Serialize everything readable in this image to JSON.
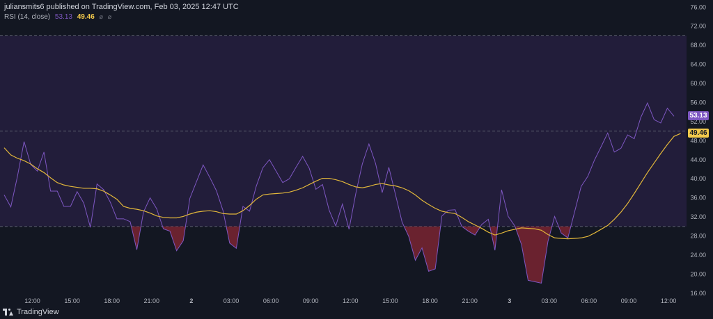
{
  "header": {
    "attribution": "juliansmits6 published on TradingView.com, Feb 03, 2025 12:47 UTC"
  },
  "legend": {
    "indicator_label": "RSI (14, close)",
    "rsi_value": "53.13",
    "ma_value": "49.46",
    "visibility_icon": "eye-off-icon",
    "settings_icon": "gear-icon"
  },
  "footer": {
    "brand": "TradingView",
    "logo_icon": "tradingview-logo-icon"
  },
  "colors": {
    "background": "#131722",
    "band_fill": "#221d3a",
    "rsi_line": "#7e57c2",
    "ma_line": "#e2b73a",
    "oversold_fill": "#7a2431",
    "dashed_level": "#5d6070",
    "axis_text": "#b2b5be",
    "rsi_tag": "#7e57c2",
    "ma_tag": "#f2c94c"
  },
  "chart_data": {
    "type": "line",
    "y_axis_ticks": [
      "76.00",
      "72.00",
      "68.00",
      "64.00",
      "60.00",
      "56.00",
      "52.00",
      "48.00",
      "44.00",
      "40.00",
      "36.00",
      "32.00",
      "28.00",
      "24.00",
      "20.00",
      "16.00"
    ],
    "x_axis_ticks": [
      "12:00",
      "15:00",
      "18:00",
      "21:00",
      "2",
      "03:00",
      "06:00",
      "09:00",
      "12:00",
      "15:00",
      "18:00",
      "21:00",
      "3",
      "03:00",
      "06:00",
      "09:00",
      "12:00"
    ],
    "ylim": [
      13.5,
      77.5
    ],
    "levels": {
      "upper": 70,
      "middle": 50,
      "lower": 30
    },
    "last_values": {
      "rsi": "53.13",
      "ma": "49.46"
    },
    "series": [
      {
        "id": "rsi",
        "values": [
          36.6,
          34.1,
          40.5,
          47.8,
          43.0,
          41.6,
          45.6,
          37.4,
          37.4,
          34.2,
          34.2,
          37.3,
          34.9,
          29.8,
          38.9,
          37.7,
          35.1,
          31.6,
          31.6,
          31.0,
          25.1,
          33.0,
          36.0,
          33.7,
          29.5,
          29.0,
          24.9,
          27.0,
          35.9,
          39.4,
          42.9,
          40.3,
          37.5,
          33.3,
          26.5,
          25.4,
          34.2,
          33.2,
          38.4,
          42.3,
          44.0,
          41.6,
          39.2,
          40.0,
          42.4,
          44.7,
          42.2,
          37.8,
          38.8,
          33.4,
          30.1,
          34.7,
          29.4,
          36.8,
          43.1,
          47.3,
          43.2,
          37.1,
          42.4,
          36.7,
          30.9,
          27.9,
          22.9,
          25.5,
          20.6,
          21.1,
          32.2,
          33.4,
          33.5,
          30.0,
          29.0,
          28.2,
          30.4,
          31.5,
          25.0,
          37.7,
          32.1,
          30.1,
          26.2,
          18.7,
          18.4,
          18.1,
          26.9,
          32.1,
          28.6,
          27.6,
          33.0,
          38.4,
          40.5,
          43.9,
          46.7,
          49.6,
          45.6,
          46.4,
          49.2,
          48.4,
          52.9,
          55.9,
          52.4,
          51.7,
          54.8,
          53.1
        ]
      },
      {
        "id": "rsi-ma",
        "values": [
          46.5,
          45.0,
          44.3,
          43.8,
          43.1,
          42.1,
          41.3,
          40.2,
          39.2,
          38.7,
          38.4,
          38.2,
          38.0,
          38.0,
          37.9,
          37.4,
          36.6,
          35.7,
          34.2,
          33.8,
          33.6,
          33.3,
          32.8,
          32.2,
          31.9,
          31.8,
          31.8,
          32.1,
          32.6,
          33.0,
          33.2,
          33.3,
          33.1,
          32.7,
          32.6,
          32.6,
          33.3,
          34.4,
          35.7,
          36.6,
          36.8,
          36.9,
          37.0,
          37.2,
          37.6,
          38.1,
          38.8,
          39.5,
          40.1,
          40.1,
          39.8,
          39.4,
          38.8,
          38.3,
          38.1,
          38.4,
          38.8,
          39.0,
          38.7,
          38.5,
          38.1,
          37.5,
          36.6,
          35.5,
          34.6,
          33.8,
          33.2,
          32.9,
          32.7,
          31.9,
          31.0,
          30.3,
          29.6,
          28.8,
          28.2,
          28.6,
          29.1,
          29.4,
          29.7,
          29.6,
          29.5,
          29.2,
          28.3,
          27.6,
          27.5,
          27.4,
          27.5,
          27.6,
          27.9,
          28.6,
          29.4,
          30.2,
          31.5,
          33.0,
          34.8,
          36.9,
          39.1,
          41.3,
          43.3,
          45.3,
          47.2,
          48.9,
          49.5
        ]
      }
    ]
  }
}
